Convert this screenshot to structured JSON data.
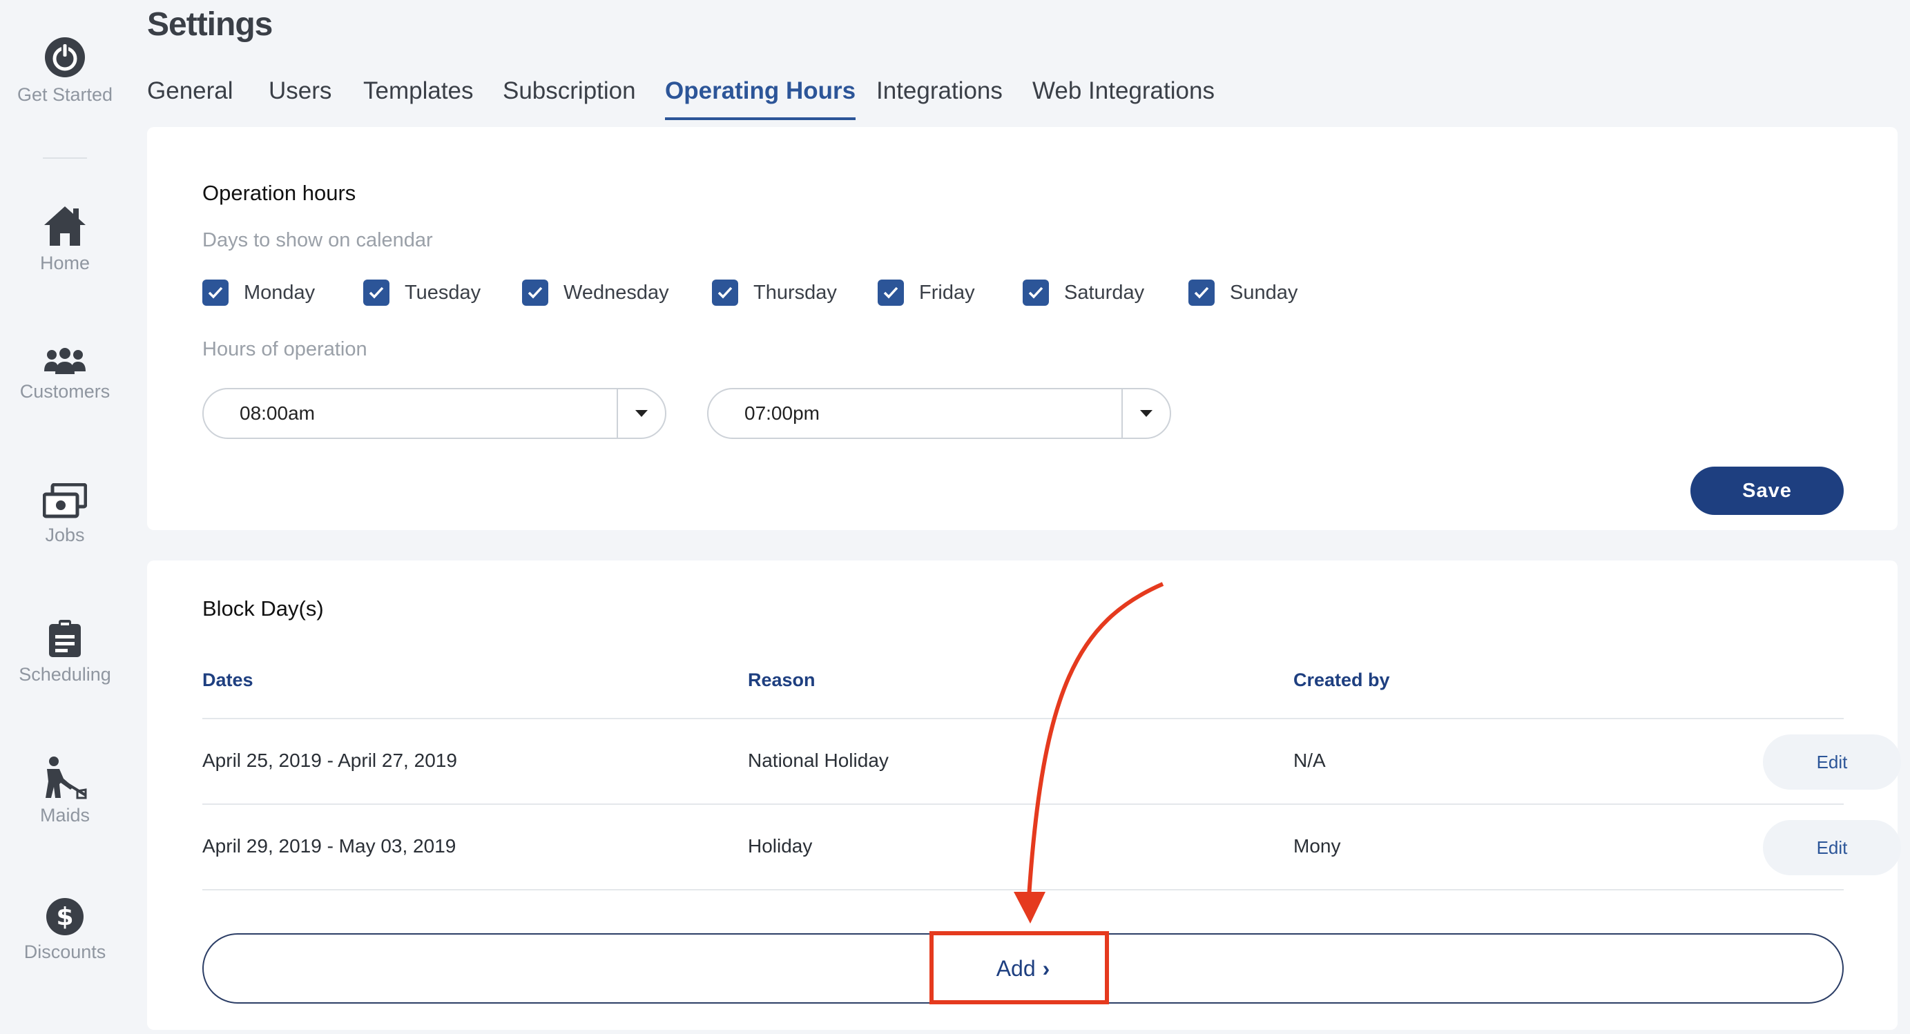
{
  "sidebar": {
    "items": [
      {
        "label": "Get Started",
        "icon": "power-icon"
      },
      {
        "label": "Home",
        "icon": "home-icon"
      },
      {
        "label": "Customers",
        "icon": "customers-icon"
      },
      {
        "label": "Jobs",
        "icon": "jobs-icon"
      },
      {
        "label": "Scheduling",
        "icon": "clipboard-icon"
      },
      {
        "label": "Maids",
        "icon": "maid-icon"
      },
      {
        "label": "Discounts",
        "icon": "dollar-icon"
      }
    ]
  },
  "header": {
    "title": "Settings",
    "tabs": [
      "General",
      "Users",
      "Templates",
      "Subscription",
      "Operating Hours",
      "Integrations",
      "Web Integrations"
    ],
    "active_tab": "Operating Hours"
  },
  "operation_hours": {
    "title": "Operation hours",
    "days_label": "Days to show on calendar",
    "days": [
      {
        "label": "Monday",
        "checked": true
      },
      {
        "label": "Tuesday",
        "checked": true
      },
      {
        "label": "Wednesday",
        "checked": true
      },
      {
        "label": "Thursday",
        "checked": true
      },
      {
        "label": "Friday",
        "checked": true
      },
      {
        "label": "Saturday",
        "checked": true
      },
      {
        "label": "Sunday",
        "checked": true
      }
    ],
    "hours_label": "Hours of operation",
    "start_time": "08:00am",
    "end_time": "07:00pm",
    "save_label": "Save"
  },
  "block_days": {
    "title": "Block Day(s)",
    "columns": [
      "Dates",
      "Reason",
      "Created by"
    ],
    "rows": [
      {
        "dates": "April 25, 2019 - April 27, 2019",
        "reason": "National Holiday",
        "created_by": "N/A",
        "action": "Edit"
      },
      {
        "dates": "April 29, 2019 - May 03, 2019",
        "reason": "Holiday",
        "created_by": "Mony",
        "action": "Edit"
      }
    ],
    "add_label": "Add",
    "add_chevron": "›"
  },
  "colors": {
    "accent": "#2c5598",
    "primary_button": "#1e3f80",
    "annotation": "#e53a1e"
  }
}
